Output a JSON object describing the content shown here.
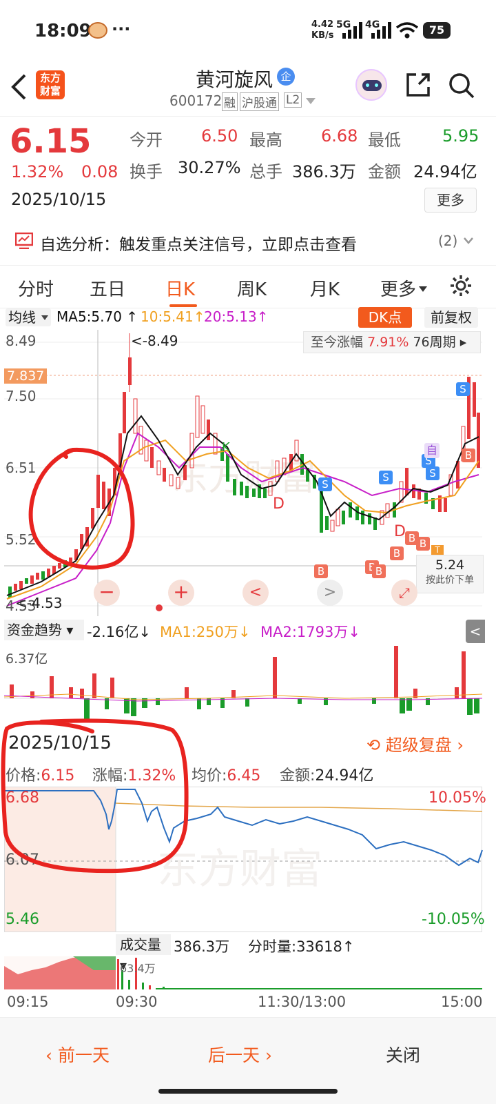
{
  "status_bar": {
    "time": "18:09",
    "dots": "···",
    "speed_value": "4.42",
    "speed_unit": "KB/s",
    "net1": "5G",
    "net2": "4G",
    "battery": "75"
  },
  "header": {
    "logo_line1": "东方",
    "logo_line2": "财富",
    "stock_name": "黄河旋风",
    "badge": "企",
    "code": "600172",
    "tag1": "融",
    "tag2": "沪股通",
    "tag3": "L2"
  },
  "quote": {
    "price": "6.15",
    "change_pct": "1.32%",
    "change_amt": "0.08",
    "date": "2025/10/15",
    "open_label": "今开",
    "open": "6.50",
    "high_label": "最高",
    "high": "6.68",
    "low_label": "最低",
    "low": "5.95",
    "turnover_label": "换手",
    "turnover": "30.27%",
    "volume_label": "总手",
    "volume": "386.3万",
    "amount_label": "金额",
    "amount": "24.94亿",
    "more_button": "更多"
  },
  "banner": {
    "text": "自选分析：触发重点关注信号，立即点击查看",
    "count": "(2)"
  },
  "tabs": [
    "分时",
    "五日",
    "日K",
    "周K",
    "月K",
    "更多"
  ],
  "active_tab": "日K",
  "ma_row": {
    "selector": "均线",
    "ma5": "MA5:5.70",
    "ma10": "10:5.41",
    "ma20": "20:5.13",
    "dk_button": "DK点",
    "adjust_button": "前复权"
  },
  "kline": {
    "y_labels": [
      "8.49",
      "7.50",
      "6.51",
      "5.52",
      "4.53"
    ],
    "current_line_label": "7.837",
    "high_marker": "<-8.49",
    "low_marker": "<-4.53",
    "range_label": "至今涨幅",
    "range_value": "7.91%",
    "range_period": "76周期",
    "price_tip_value": "5.24",
    "price_tip_text": "按此价下单",
    "signals": [
      "S",
      "S",
      "S",
      "S",
      "S",
      "B",
      "B",
      "B",
      "B",
      "B",
      "B",
      "B",
      "D",
      "D",
      "T",
      "K",
      "自"
    ]
  },
  "fund_flow": {
    "selector": "资金趋势",
    "value": "-2.16亿",
    "ma1": "MA1:250万",
    "ma2": "MA2:1793万",
    "y_label": "6.37亿"
  },
  "intraday": {
    "date": "2025/10/15",
    "replay_button": "超级复盘",
    "price_label": "价格:",
    "price": "6.15",
    "change_label": "涨幅:",
    "change": "1.32%",
    "avg_label": "均价:",
    "avg": "6.45",
    "amount_label": "金额:",
    "amount": "24.94亿",
    "y_top": "6.68",
    "y_mid": "6.07",
    "y_bottom": "5.46",
    "pct_top": "10.05%",
    "pct_bottom": "-10.05%",
    "watermark": "东方财富",
    "volume_selector": "成交量",
    "volume_value": "386.3万",
    "tick_volume": "分时量:33618",
    "vol_peak": "63.4万",
    "time_labels": [
      "09:15",
      "09:30",
      "11:30/13:00",
      "15:00"
    ]
  },
  "footer": {
    "prev": "前一天",
    "next": "后一天",
    "close": "关闭"
  },
  "colors": {
    "up": "#e4393c",
    "down": "#1a9c2a",
    "accent": "#f25a1d",
    "ma5": "#111111",
    "ma10": "#f0a020",
    "ma20": "#c71ec8",
    "annotation": "#e8231f"
  }
}
